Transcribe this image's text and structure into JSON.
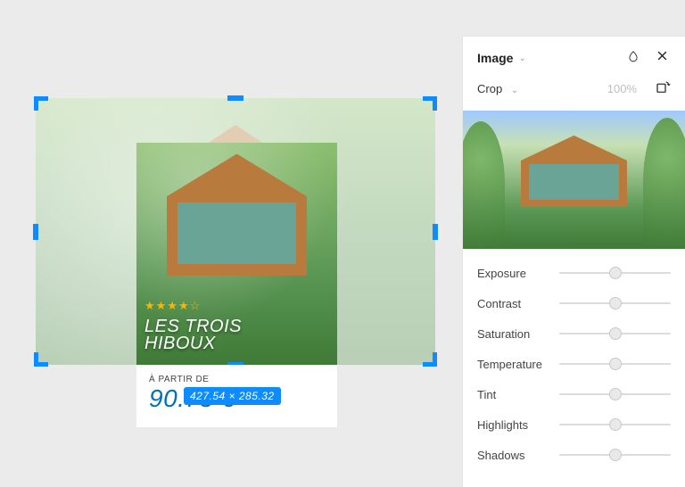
{
  "panel": {
    "title": "Image",
    "crop_label": "Crop",
    "zoom": "100%"
  },
  "adjustments": [
    {
      "label": "Exposure",
      "value": 50
    },
    {
      "label": "Contrast",
      "value": 50
    },
    {
      "label": "Saturation",
      "value": 50
    },
    {
      "label": "Temperature",
      "value": 50
    },
    {
      "label": "Tint",
      "value": 50
    },
    {
      "label": "Highlights",
      "value": 50
    },
    {
      "label": "Shadows",
      "value": 50
    }
  ],
  "selection": {
    "size_badge": "427.54 × 285.32"
  },
  "card": {
    "stars": "★★★★☆",
    "title_line1": "LES TROIS",
    "title_line2": "HIBOUX",
    "from_label": "À PARTIR DE",
    "price": "90.75 €"
  }
}
